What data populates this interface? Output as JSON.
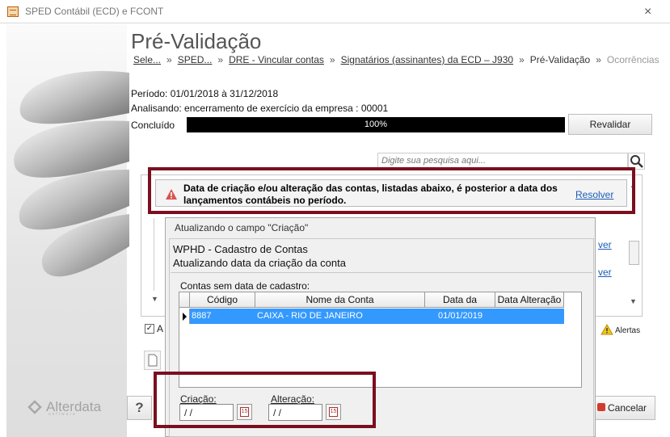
{
  "window": {
    "title": "SPED Contábil (ECD) e FCONT",
    "close_glyph": "×"
  },
  "brand": {
    "name": "Alterdata",
    "tagline": "software"
  },
  "page": {
    "title": "Pré-Validação"
  },
  "breadcrumb": {
    "items": [
      "Sele...",
      "SPED...",
      "DRE - Vincular contas",
      "Signatários (assinantes) da ECD – J930"
    ],
    "current": "Pré-Validação",
    "next": "Ocorrências",
    "separator": "»"
  },
  "info": {
    "periodo": "Período: 01/01/2018 à 31/12/2018",
    "analisando": "Analisando: encerramento de exercício da empresa : 00001",
    "concluido_label": "Concluído",
    "progress_text": "100%",
    "progress_value": 100
  },
  "buttons": {
    "revalidar": "Revalidar",
    "help": "?",
    "cancelar": "Cancelar"
  },
  "search": {
    "placeholder": "Digite sua pesquisa aqui..."
  },
  "alert": {
    "message": "Data de criação e/ou alteração das contas, listadas abaixo, é posterior a data dos lançamentos contábeis no período.",
    "resolver": "Resolver",
    "resolver_partial": "ver"
  },
  "footer": {
    "checkbox_label": "A",
    "checkbox_checked": true,
    "alerts_label": "Alertas"
  },
  "dialog": {
    "title": "Atualizando o campo \"Criação\"",
    "heading1": "WPHD - Cadastro de Contas",
    "heading2": "Atualizando data da criação da conta",
    "grid_label": "Contas sem data de cadastro:",
    "columns": [
      "Código",
      "Nome da Conta",
      "Data da Criação",
      "Data Alteração"
    ],
    "rows": [
      {
        "codigo": "8887",
        "nome": "CAIXA - RIO DE JANEIRO",
        "criacao": "01/01/2019",
        "alteracao": ""
      }
    ],
    "criacao_label": "Criação:",
    "criacao_value": " / /",
    "alteracao_label": "Alteração:",
    "alteracao_value": " / /",
    "calendar_day": "15"
  },
  "colors": {
    "accent_red": "#7a0f1e",
    "selection": "#3399ff",
    "link": "#1a5cb8"
  }
}
